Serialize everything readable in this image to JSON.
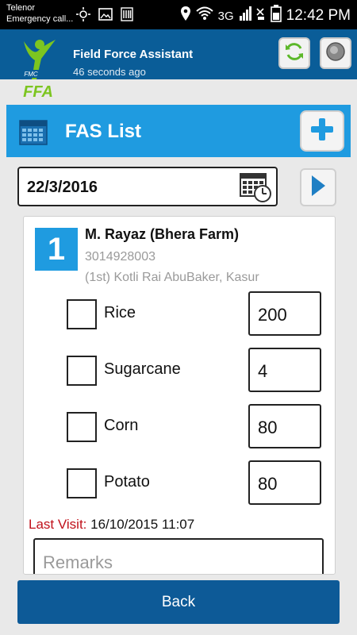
{
  "status_bar": {
    "carrier": "Telenor",
    "carrier_sub": "Emergency call...",
    "network": "3G",
    "time": "12:42 PM"
  },
  "header": {
    "title": "Field Force Assistant",
    "subtitle": "46 seconds ago",
    "logo_text": "FFA",
    "logo_sub": "FMC"
  },
  "list": {
    "title": "FAS List"
  },
  "date": {
    "value": "22/3/2016"
  },
  "farm": {
    "number": "1",
    "name": "M. Rayaz (Bhera Farm)",
    "phone": "3014928003",
    "address": "(1st) Kotli Rai AbuBaker, Kasur",
    "crops": [
      {
        "label": "Rice",
        "quantity": "200"
      },
      {
        "label": "Sugarcane",
        "quantity": "4"
      },
      {
        "label": "Corn",
        "quantity": "80"
      },
      {
        "label": "Potato",
        "quantity": "80"
      }
    ],
    "last_visit_label": "Last Visit:",
    "last_visit_value": "16/10/2015 11:07",
    "remarks_placeholder": "Remarks"
  },
  "footer": {
    "back_label": "Back"
  },
  "colors": {
    "appbar": "#0a5d98",
    "accent": "#1f9be0",
    "back_button": "#0d5a97",
    "last_visit_label": "#c0101a"
  }
}
